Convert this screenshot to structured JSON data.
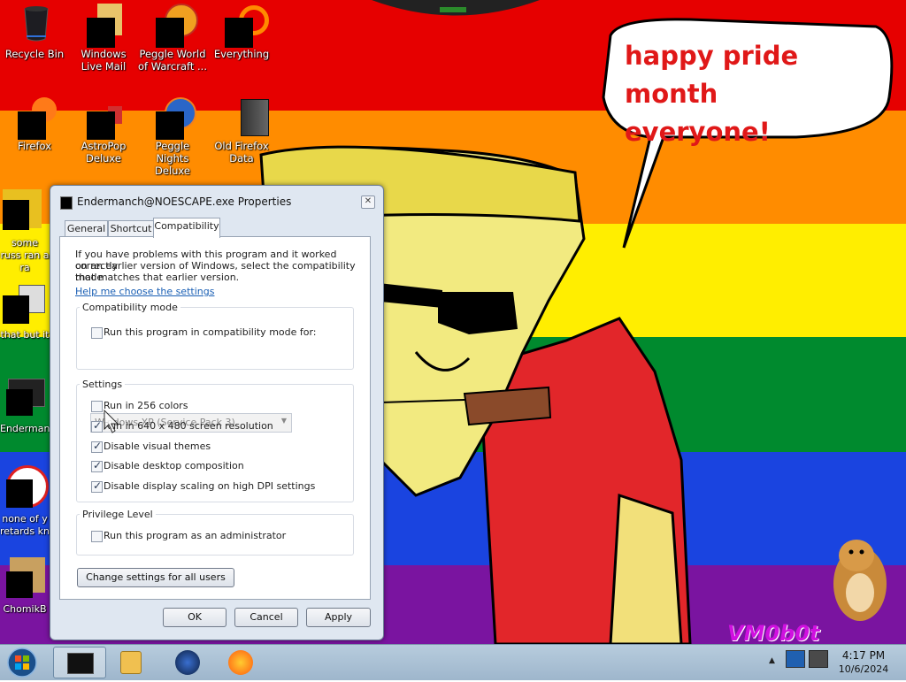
{
  "wallpaper": {
    "speech_bubble": [
      "happy pride month",
      "everyone!"
    ],
    "watermark": "VM0b0t",
    "stripe_colors": [
      "#e60000",
      "#ff8c00",
      "#ffee00",
      "#008a2e",
      "#1a44e0",
      "#7a14a0"
    ]
  },
  "desktop_icons": [
    {
      "label": "Recycle Bin",
      "icon": "recycle-bin-icon"
    },
    {
      "label": "Windows Live Mail",
      "icon": "mail-icon"
    },
    {
      "label": "Peggle World of Warcraft ...",
      "icon": "game-icon"
    },
    {
      "label": "Everything",
      "icon": "search-icon"
    },
    {
      "label": "Firefox",
      "icon": "firefox-icon"
    },
    {
      "label": "AstroPop Deluxe",
      "icon": "game-icon"
    },
    {
      "label": "Peggle Nights Deluxe",
      "icon": "game-icon"
    },
    {
      "label": "Old Firefox Data",
      "icon": "folder-icon"
    },
    {
      "label": "some russ ran a ra",
      "icon": "file-icon"
    },
    {
      "label": "that but it",
      "icon": "file-icon"
    },
    {
      "label": "Enderman",
      "icon": "exe-icon"
    },
    {
      "label": "none of y retards kn",
      "icon": "file-icon"
    },
    {
      "label": "ChomikB",
      "icon": "file-icon"
    }
  ],
  "dialog": {
    "title": "Endermanch@NOESCAPE.exe Properties",
    "tabs": [
      "General",
      "Shortcut",
      "Compatibility"
    ],
    "active_tab": "Compatibility",
    "intro": [
      "If you have problems with this program and it worked correctly",
      "on an earlier version of Windows, select the compatibility mode",
      "that matches that earlier version."
    ],
    "help_link": "Help me choose the settings",
    "compat_mode": {
      "title": "Compatibility mode",
      "checkbox": {
        "label": "Run this program in compatibility mode for:",
        "checked": false
      },
      "dropdown_value": "Windows XP (Service Pack 3)"
    },
    "settings": {
      "title": "Settings",
      "options": [
        {
          "label": "Run in 256 colors",
          "checked": false
        },
        {
          "label": "Run in 640 x 480 screen resolution",
          "checked": true
        },
        {
          "label": "Disable visual themes",
          "checked": true
        },
        {
          "label": "Disable desktop composition",
          "checked": true
        },
        {
          "label": "Disable display scaling on high DPI settings",
          "checked": true
        }
      ]
    },
    "privilege": {
      "title": "Privilege Level",
      "checkbox": {
        "label": "Run this program as an administrator",
        "checked": false
      }
    },
    "change_all_button": "Change settings for all users",
    "ok_button": "OK",
    "cancel_button": "Cancel",
    "apply_button": "Apply",
    "close_glyph": "✕"
  },
  "taskbar": {
    "pinned": [
      "explorer-icon",
      "media-player-icon",
      "browser-icon",
      "firefox-icon"
    ],
    "clock_time": "4:17 PM",
    "clock_date": "10/6/2024"
  }
}
